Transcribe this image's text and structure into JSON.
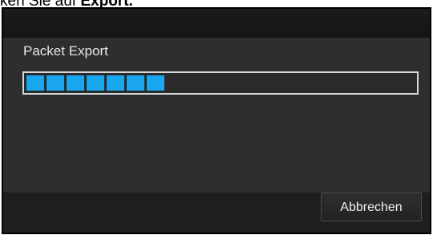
{
  "caption": {
    "prefix": "ken Sie auf ",
    "bold": "Export."
  },
  "dialog": {
    "label": "Packet Export",
    "progress": {
      "filled_segments": 7,
      "total_segments": 20,
      "fill_color": "#1aa7f0"
    },
    "cancel_label": "Abbrechen"
  }
}
